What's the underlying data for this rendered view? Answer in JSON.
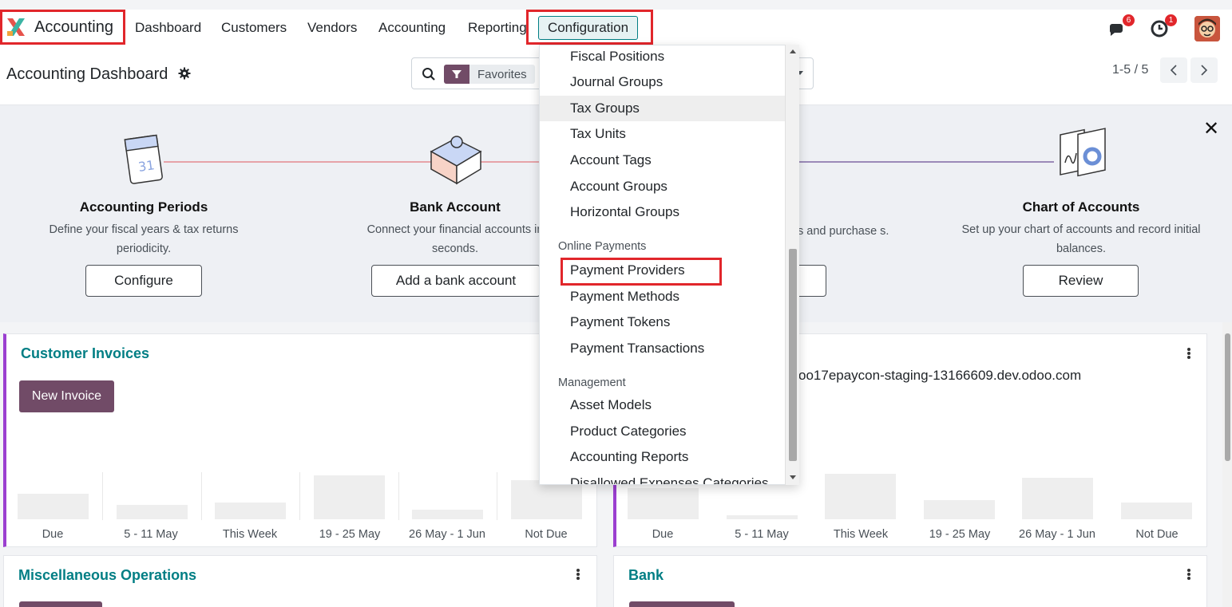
{
  "nav": {
    "app_name": "Accounting",
    "items": [
      "Dashboard",
      "Customers",
      "Vendors",
      "Accounting",
      "Reporting"
    ],
    "config_label": "Configuration",
    "messages_badge": "6",
    "activities_badge": "1"
  },
  "control": {
    "title": "Accounting Dashboard",
    "filter_label": "Favorites",
    "pager": "1-5 / 5"
  },
  "onboarding": {
    "steps": [
      {
        "title": "Accounting Periods",
        "desc": "Define your fiscal years & tax returns periodicity.",
        "button": "Configure"
      },
      {
        "title": "Bank Account",
        "desc": "Connect your financial accounts in seconds.",
        "button": "Add a bank account"
      },
      {
        "desc_partial": "s and purchase s."
      },
      {
        "title": "Chart of Accounts",
        "desc": "Set up your chart of accounts and record initial balances.",
        "button": "Review"
      }
    ],
    "calendar_day": "31"
  },
  "cards": {
    "customer_invoices": {
      "title": "Customer Invoices",
      "button": "New Invoice"
    },
    "second": {
      "url_text": "oo17epaycon-staging-13166609.dev.odoo.com"
    },
    "misc": {
      "title": "Miscellaneous Operations"
    },
    "bank": {
      "title": "Bank"
    },
    "x_labels": [
      "Due",
      "5 - 11 May",
      "This Week",
      "19 - 25 May",
      "26 May - 1 Jun",
      "Not Due"
    ]
  },
  "dropdown": {
    "items_top": [
      "Fiscal Positions",
      "Journal Groups",
      "Tax Groups",
      "Tax Units",
      "Account Tags",
      "Account Groups",
      "Horizontal Groups"
    ],
    "header_online": "Online Payments",
    "items_online": [
      "Payment Providers",
      "Payment Methods",
      "Payment Tokens",
      "Payment Transactions"
    ],
    "header_management": "Management",
    "items_management": [
      "Asset Models",
      "Product Categories",
      "Accounting Reports",
      "Disallowed Expenses Categories"
    ],
    "active_item": "Tax Groups"
  },
  "colors": {
    "brand": "#714b67",
    "teal": "#017e84",
    "highlight_red": "#e1262b"
  },
  "icons": [
    "search-icon",
    "filter-icon",
    "gear-icon",
    "messages-icon",
    "clock-icon",
    "close-icon",
    "kebab-icon",
    "chevron-left-icon",
    "chevron-right-icon"
  ]
}
